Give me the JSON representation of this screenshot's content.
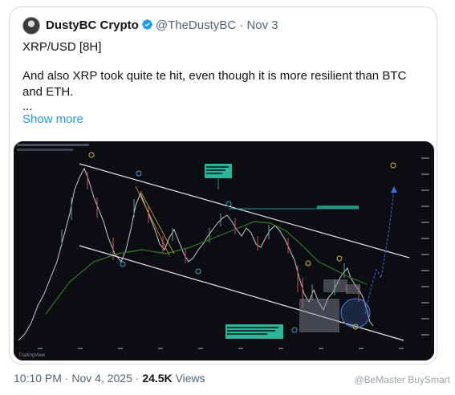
{
  "tweet": {
    "author_name": "DustyBC Crypto",
    "handle": "@TheDustyBC",
    "separator": "·",
    "date": "Nov 3",
    "pair": "XRP/USD [8H]",
    "body": "And also XRP took quite te hit, even though it is more resilient than BTC and ETH.",
    "ellipsis": "...",
    "show_more": "Show more"
  },
  "chart_image": {
    "tv_label": "TradingView",
    "callout_top": "In doing so we didn't move through 50% (or in technicality a 0.5 fib) resistance",
    "callout_right": "More watching confirmations a bit here",
    "callout_bottom": "after the huge liquidation wick, it is very likely and still offside though! This box is where it resides."
  },
  "footer": {
    "time": "10:10 PM · Nov 4, 2025 ·",
    "views_count": "24.5K",
    "views_label": "Views",
    "watermark": "@BeMaster BuySmart"
  },
  "colors": {
    "link": "#1d9bf0",
    "verified": "#1d9bf0",
    "chart_bg": "#0b0d12",
    "channel_line": "#e8e8e8",
    "ma_line": "#2f7a2a",
    "projection": "#3a6fe0"
  }
}
